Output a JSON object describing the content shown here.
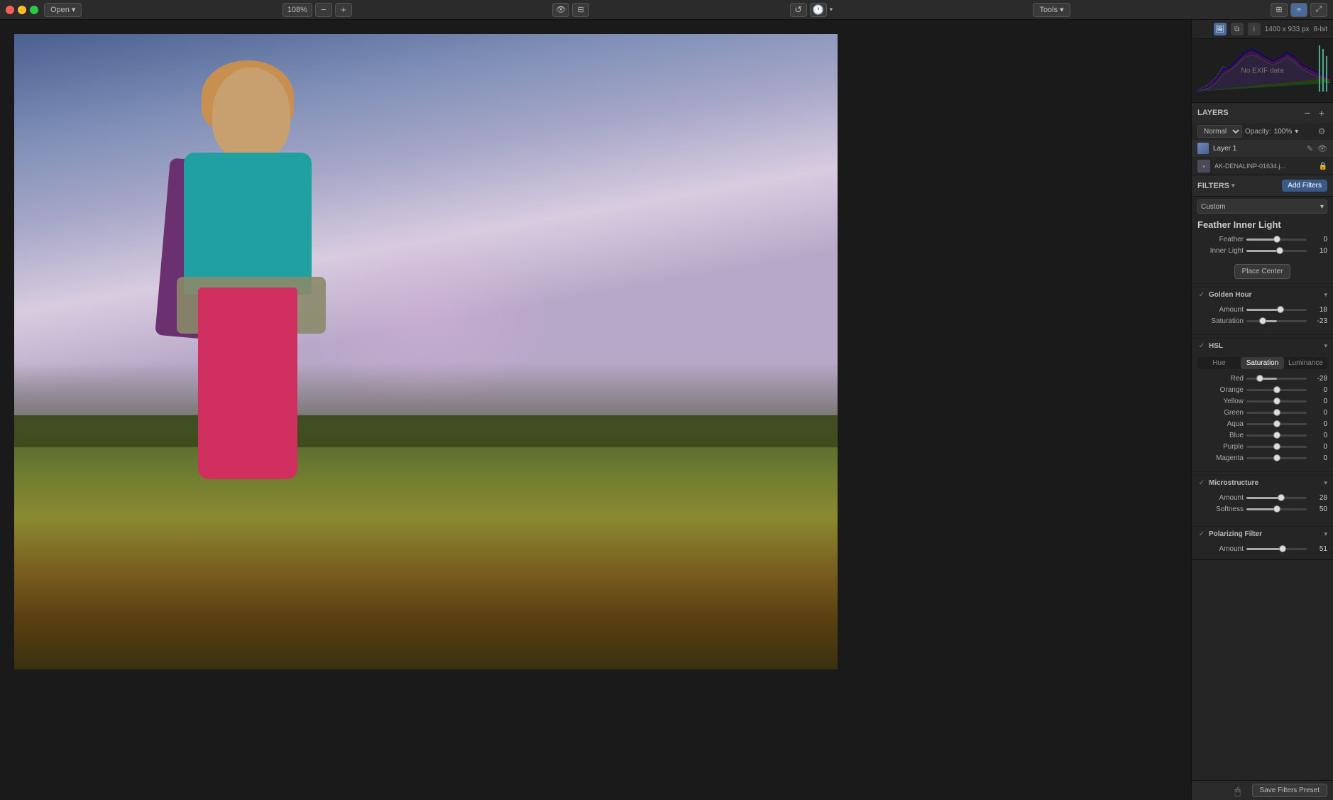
{
  "titlebar": {
    "open_label": "Open",
    "zoom_value": "108%",
    "tools_label": "Tools"
  },
  "info_bar": {
    "dimensions": "1400 x 933 px",
    "bit_depth": "8-bit",
    "no_exif": "No EXIF data"
  },
  "layers": {
    "title": "LAYERS",
    "blend_mode": "Normal",
    "opacity_label": "Opacity:",
    "opacity_value": "100%",
    "layer_name": "Layer 1",
    "file_name": "AK-DENALINP-01634.j..."
  },
  "filters": {
    "title": "FILTERS",
    "add_btn": "Add Filters",
    "custom_label": "Custom",
    "preset_name": "Feather Inner Light",
    "feather_label": "Feather",
    "feather_value": "0",
    "inner_light_label": "Inner Light",
    "inner_light_value": "10",
    "place_center_btn": "Place Center"
  },
  "golden_hour": {
    "title": "Golden Hour",
    "amount_label": "Amount",
    "amount_value": "18",
    "saturation_label": "Saturation",
    "saturation_value": "-23"
  },
  "hsl": {
    "title": "HSL",
    "tabs": [
      "Hue",
      "Saturation",
      "Luminance"
    ],
    "active_tab": "Saturation",
    "colors": [
      {
        "name": "Red",
        "value": "-28"
      },
      {
        "name": "Orange",
        "value": "0"
      },
      {
        "name": "Yellow",
        "value": "0"
      },
      {
        "name": "Green",
        "value": "0"
      },
      {
        "name": "Aqua",
        "value": "0"
      },
      {
        "name": "Blue",
        "value": "0"
      },
      {
        "name": "Purple",
        "value": "0"
      },
      {
        "name": "Magenta",
        "value": "0"
      }
    ]
  },
  "microstructure": {
    "title": "Microstructure",
    "amount_label": "Amount",
    "amount_value": "28",
    "softness_label": "Softness",
    "softness_value": "50"
  },
  "polarizing_filter": {
    "title": "Polarizing Filter",
    "amount_label": "Amount",
    "amount_value": "51"
  },
  "bottom": {
    "save_btn": "Save Filters Preset"
  }
}
